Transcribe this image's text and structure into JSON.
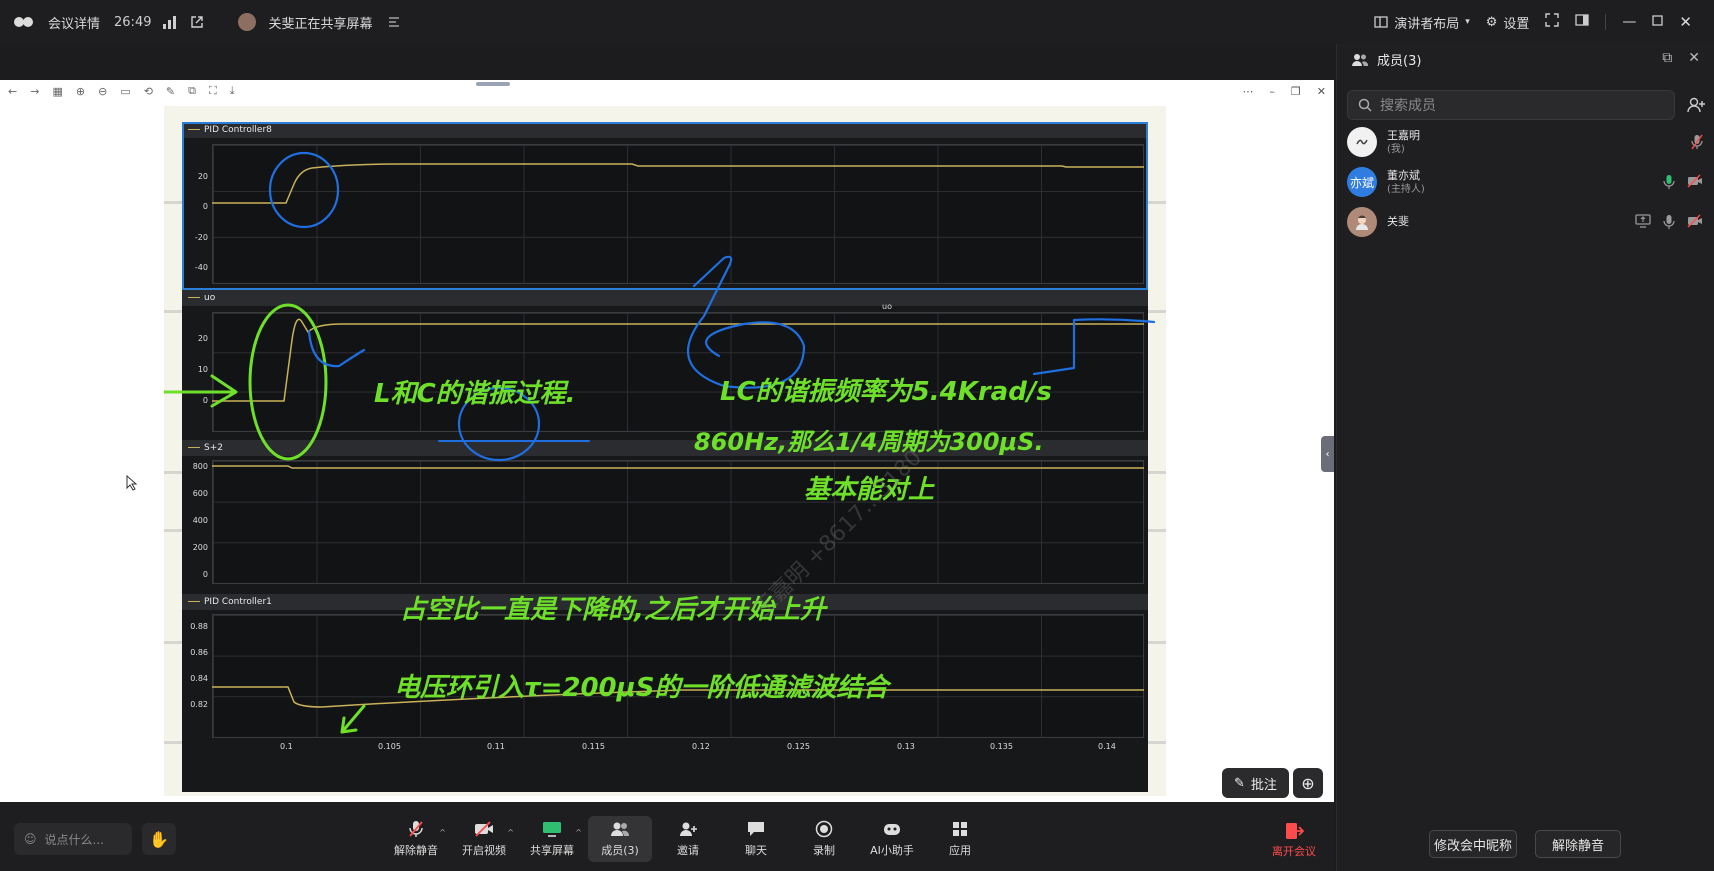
{
  "topbar": {
    "meeting_details": "会议详情",
    "timer": "26:49",
    "sharing_status": "关斐正在共享屏幕",
    "layout_label": "演讲者布局",
    "settings_label": "设置"
  },
  "shared_screen": {
    "watermark": "王嘉明 +8617…3180",
    "scope": {
      "panels": [
        {
          "title": "PID Controller8",
          "yticks": [
            "20",
            "0",
            "-20",
            "-40"
          ]
        },
        {
          "title": "uo",
          "subtitle": "uo",
          "yticks": [
            "20",
            "10",
            "0"
          ]
        },
        {
          "title": "S+2",
          "yticks": [
            "800",
            "600",
            "400",
            "200",
            "0"
          ]
        },
        {
          "title": "PID Controller1",
          "yticks": [
            "0.88",
            "0.86",
            "0.84",
            "0.82"
          ]
        }
      ],
      "xticks": [
        "0.1",
        "0.105",
        "0.11",
        "0.115",
        "0.12",
        "0.125",
        "0.13",
        "0.135",
        "0.14"
      ]
    },
    "annotations": [
      "L和C的谐振过程.",
      "LC的谐振频率为5.4Krad/s",
      "860Hz,那么1/4周期为300μS.",
      "基本能对上",
      "占空比一直是下降的,之后才开始上升",
      "电压环引入τ=200μS的一阶低通滤波结合"
    ],
    "annotate_button": "批注"
  },
  "bottombar": {
    "chat_placeholder": "说点什么...",
    "tools": [
      {
        "label": "解除静音",
        "icon": "mic-muted-icon"
      },
      {
        "label": "开启视频",
        "icon": "camera-off-icon"
      },
      {
        "label": "共享屏幕",
        "icon": "share-screen-icon"
      },
      {
        "label": "成员(3)",
        "icon": "members-icon"
      },
      {
        "label": "邀请",
        "icon": "invite-icon"
      },
      {
        "label": "聊天",
        "icon": "chat-icon"
      },
      {
        "label": "录制",
        "icon": "record-icon"
      },
      {
        "label": "AI小助手",
        "icon": "ai-assistant-icon"
      },
      {
        "label": "应用",
        "icon": "apps-icon"
      }
    ],
    "leave_label": "离开会议"
  },
  "members": {
    "title": "成员(3)",
    "search_placeholder": "搜索成员",
    "list": [
      {
        "name": "王嘉明",
        "sub": "(我)",
        "avatar_text": ""
      },
      {
        "name": "董亦斌",
        "sub": "(主持人)",
        "avatar_text": "亦斌"
      },
      {
        "name": "关斐",
        "sub": "",
        "avatar_text": ""
      }
    ],
    "rename_button": "修改会中昵称",
    "unmute_button": "解除静音"
  },
  "colors": {
    "accent": "#2c7fd8",
    "leave": "#ff4b4b",
    "annotation_green": "#6fe02a",
    "annotation_blue": "#1f6fe0",
    "trace_yellow": "#c9b15a"
  }
}
